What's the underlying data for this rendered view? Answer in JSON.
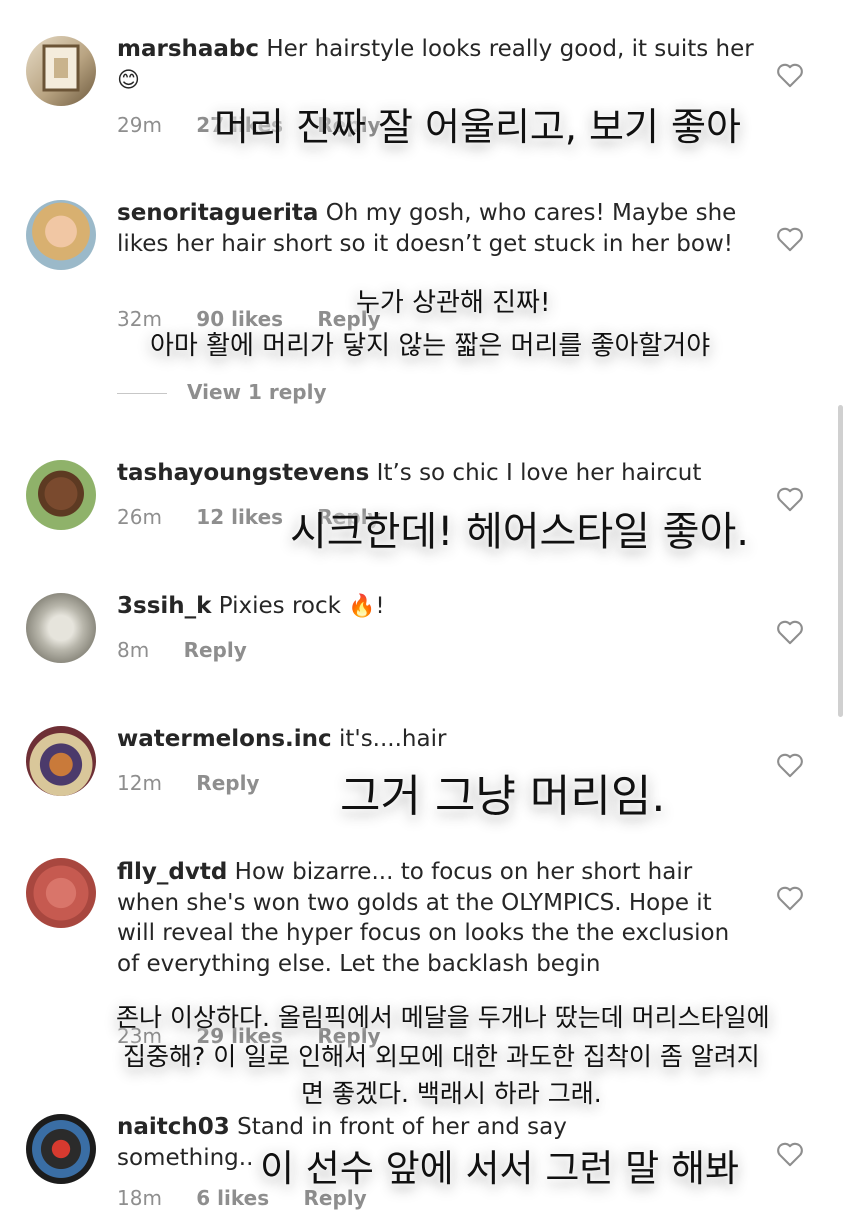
{
  "comments": [
    {
      "username": "marshaabc",
      "text": "Her hairstyle looks really good, it suits her",
      "emoji": "😊",
      "time": "29m",
      "likes": "27 likes",
      "reply": "Reply",
      "ko": "머리 진짜 잘 어울리고, 보기 좋아"
    },
    {
      "username": "senoritaguerita",
      "text": "Oh my gosh, who cares! Maybe she likes her hair short so it doesn’t get stuck in her bow!",
      "time": "32m",
      "likes": "90 likes",
      "reply": "Reply",
      "ko1": "누가 상관해 진짜!",
      "ko2": "아마 활에 머리가 닿지 않는 짧은 머리를 좋아할거야",
      "view_replies": "View 1 reply"
    },
    {
      "username": "tashayoungstevens",
      "text": "It’s so chic I love her haircut",
      "time": "26m",
      "likes": "12 likes",
      "reply": "Reply",
      "ko": "시크한데! 헤어스타일 좋아."
    },
    {
      "username": "3ssih_k",
      "text": "Pixies rock",
      "emoji": "🔥!",
      "time": "8m",
      "reply": "Reply"
    },
    {
      "username": "watermelons.inc",
      "text": "it's....hair",
      "time": "12m",
      "reply": "Reply",
      "ko": "그거 그냥 머리임."
    },
    {
      "username": "flly_dvtd",
      "text": "How bizarre... to focus on her short hair when she's won two golds at the OLYMPICS. Hope it will reveal the hyper focus on looks the the exclusion of everything else. Let the backlash begin",
      "time": "23m",
      "likes": "29 likes",
      "reply": "Reply",
      "ko1": "존나 이상하다. 올림픽에서 메달을 두개나 땄는데 머리스타일에",
      "ko2": "집중해? 이 일로 인해서 외모에 대한 과도한 집착이 좀 알려지",
      "ko3": "면 좋겠다. 백래시 하라 그래."
    },
    {
      "username": "naitch03",
      "text": "Stand in front of her and say something..",
      "time": "18m",
      "likes": "6 likes",
      "reply": "Reply",
      "ko": "이 선수 앞에 서서 그런 말 해봐"
    }
  ]
}
